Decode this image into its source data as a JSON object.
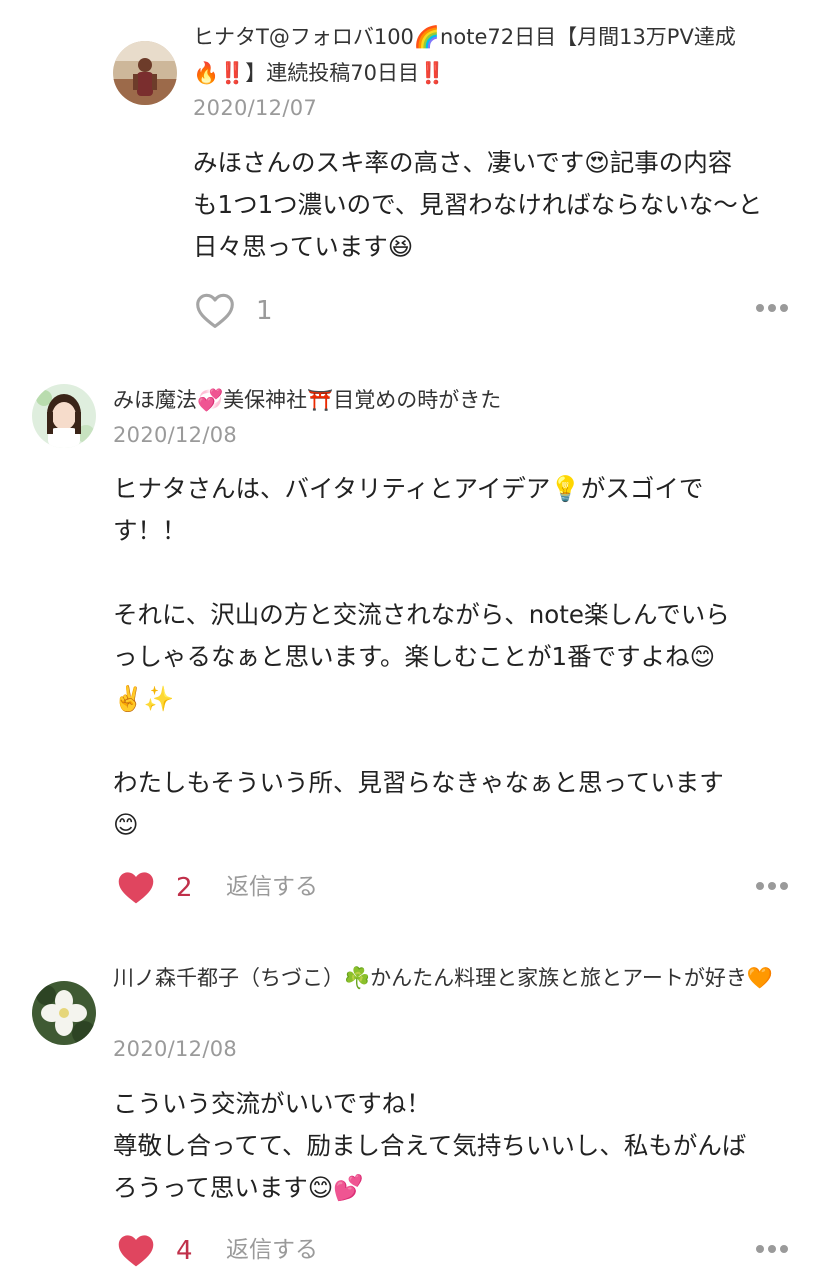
{
  "comments": [
    {
      "author": "ヒナタT@フォロバ100🌈note72日目【月間13万PV達成🔥‼️】連続投稿70日目‼️",
      "date": "2020/12/07",
      "paragraphs": [
        [
          "みほさんのスキ率の高さ、凄いです😍記事の内容",
          "も1つ1つ濃いので、見習わなければならないな〜と",
          "日々思っています😆"
        ]
      ],
      "likes": "1"
    },
    {
      "author": "みほ魔法💞美保神社⛩️目覚めの時がきた",
      "date": "2020/12/08",
      "paragraphs": [
        [
          "ヒナタさんは、バイタリティとアイデア💡がスゴイで",
          "す！！"
        ],
        [
          "それに、沢山の方と交流されながら、note楽しんでいら",
          "っしゃるなぁと思います。楽しむことが1番ですよね😊",
          "✌️✨"
        ],
        [
          "わたしもそういう所、見習らなきゃなぁと思っています",
          "😊"
        ]
      ],
      "likes": "2",
      "reply_label": "返信する"
    },
    {
      "author": "川ノ森千都子（ちづこ）☘️かんたん料理と家族と旅とアートが好き🧡",
      "date": "2020/12/08",
      "paragraphs": [
        [
          "こういう交流がいいですね！",
          "尊敬し合ってて、励まし合えて気持ちいいし、私もがんば",
          "ろうって思います😊💕"
        ]
      ],
      "likes": "4",
      "reply_label": "返信する"
    }
  ],
  "colors": {
    "text": "#222222",
    "muted": "#9a9a9a",
    "heart_liked": "#e0455f",
    "count_liked": "#c0304a"
  },
  "icons": [
    "heart-outline-icon",
    "heart-filled-icon",
    "more-dots-icon"
  ]
}
